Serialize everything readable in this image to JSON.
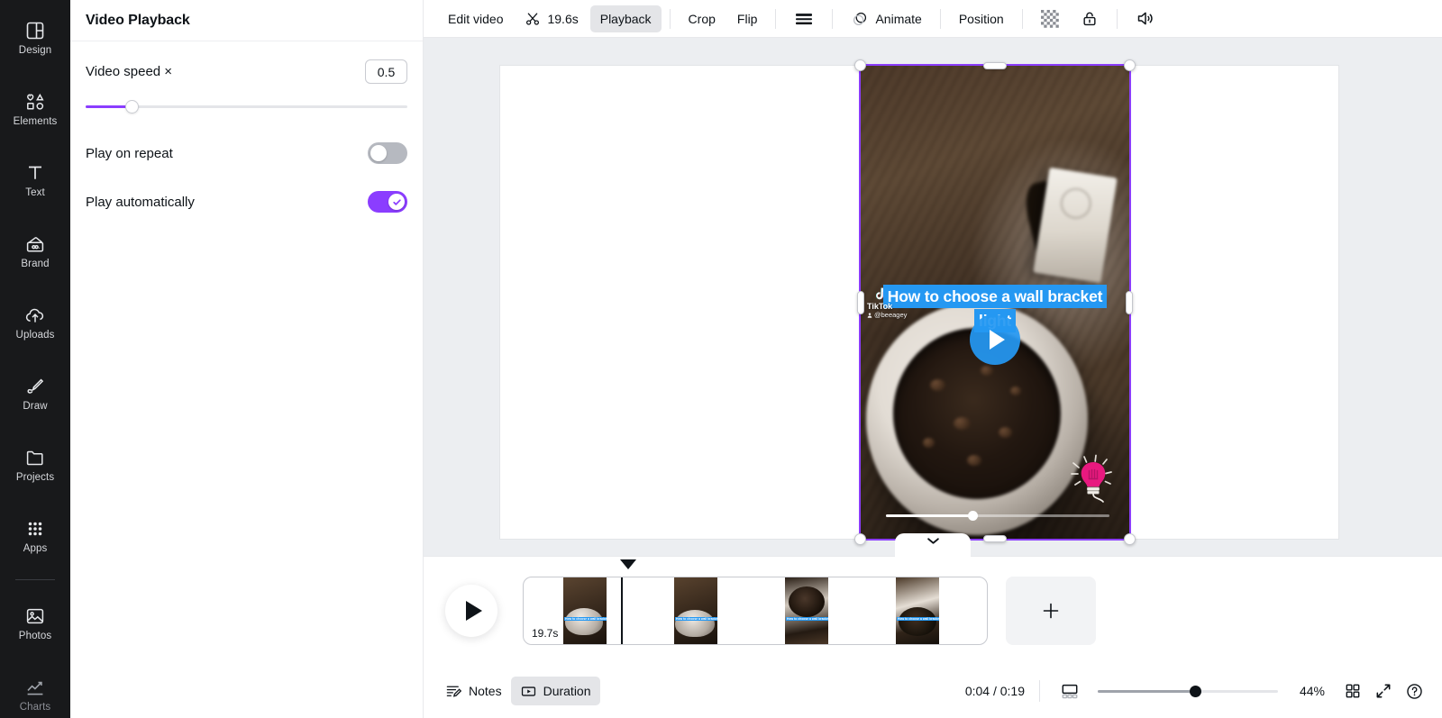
{
  "sidebar": {
    "items": [
      {
        "label": "Design",
        "icon": "design-icon"
      },
      {
        "label": "Elements",
        "icon": "elements-icon"
      },
      {
        "label": "Text",
        "icon": "text-icon"
      },
      {
        "label": "Brand",
        "icon": "brand-icon"
      },
      {
        "label": "Uploads",
        "icon": "uploads-icon"
      },
      {
        "label": "Draw",
        "icon": "draw-icon"
      },
      {
        "label": "Projects",
        "icon": "projects-icon"
      },
      {
        "label": "Apps",
        "icon": "apps-icon"
      },
      {
        "label": "Photos",
        "icon": "photos-icon"
      },
      {
        "label": "Charts",
        "icon": "charts-icon"
      }
    ]
  },
  "panel": {
    "title": "Video Playback",
    "speed": {
      "label": "Video speed ×",
      "value": "0.5",
      "slider_percent": 14.5
    },
    "repeat": {
      "label": "Play on repeat",
      "state": "off"
    },
    "autoplay": {
      "label": "Play automatically",
      "state": "on"
    },
    "accent_color": "#8b3dff"
  },
  "toolbar": {
    "edit_video": "Edit video",
    "trim_duration": "19.6s",
    "playback": "Playback",
    "crop": "Crop",
    "flip": "Flip",
    "animate": "Animate",
    "position": "Position",
    "icons": {
      "scissors": "scissors-icon",
      "lines": "lines-icon",
      "animate": "animate-icon",
      "transparency": "transparency-icon",
      "lock": "lock-icon",
      "volume": "volume-icon"
    }
  },
  "canvas": {
    "video": {
      "caption_line1": "How to choose a wall bracket",
      "caption_line2": "light",
      "caption_bg": "#2598f2",
      "watermark_name": "TikTok",
      "watermark_user": "@beeagey",
      "progress_percent": 39,
      "selection_color": "#8b3dff"
    },
    "fabs": {
      "comment": "add-comment-icon",
      "magic": "magic-sparkles-icon",
      "rotate": "rotate-icon"
    }
  },
  "timeline": {
    "page_duration": "19.7s",
    "add_page_label": "+",
    "playhead_percent": 21,
    "thumbnails": [
      {
        "caption": "How to choose a wall bracket light"
      },
      {
        "caption": "How to choose a wall bracket light"
      },
      {
        "caption": "How to choose a wall bracket"
      },
      {
        "caption": "How to choose a wall bracket"
      }
    ]
  },
  "bottombar": {
    "notes": "Notes",
    "duration": "Duration",
    "time_readout": "0:04 / 0:19",
    "zoom_percent": "44%",
    "zoom_slider_percent": 54,
    "icons": {
      "notes": "notes-icon",
      "duration": "duration-icon",
      "timeline-view": "timeline-view-icon",
      "grid": "grid-view-icon",
      "fullscreen": "fullscreen-icon",
      "help": "help-icon"
    }
  }
}
